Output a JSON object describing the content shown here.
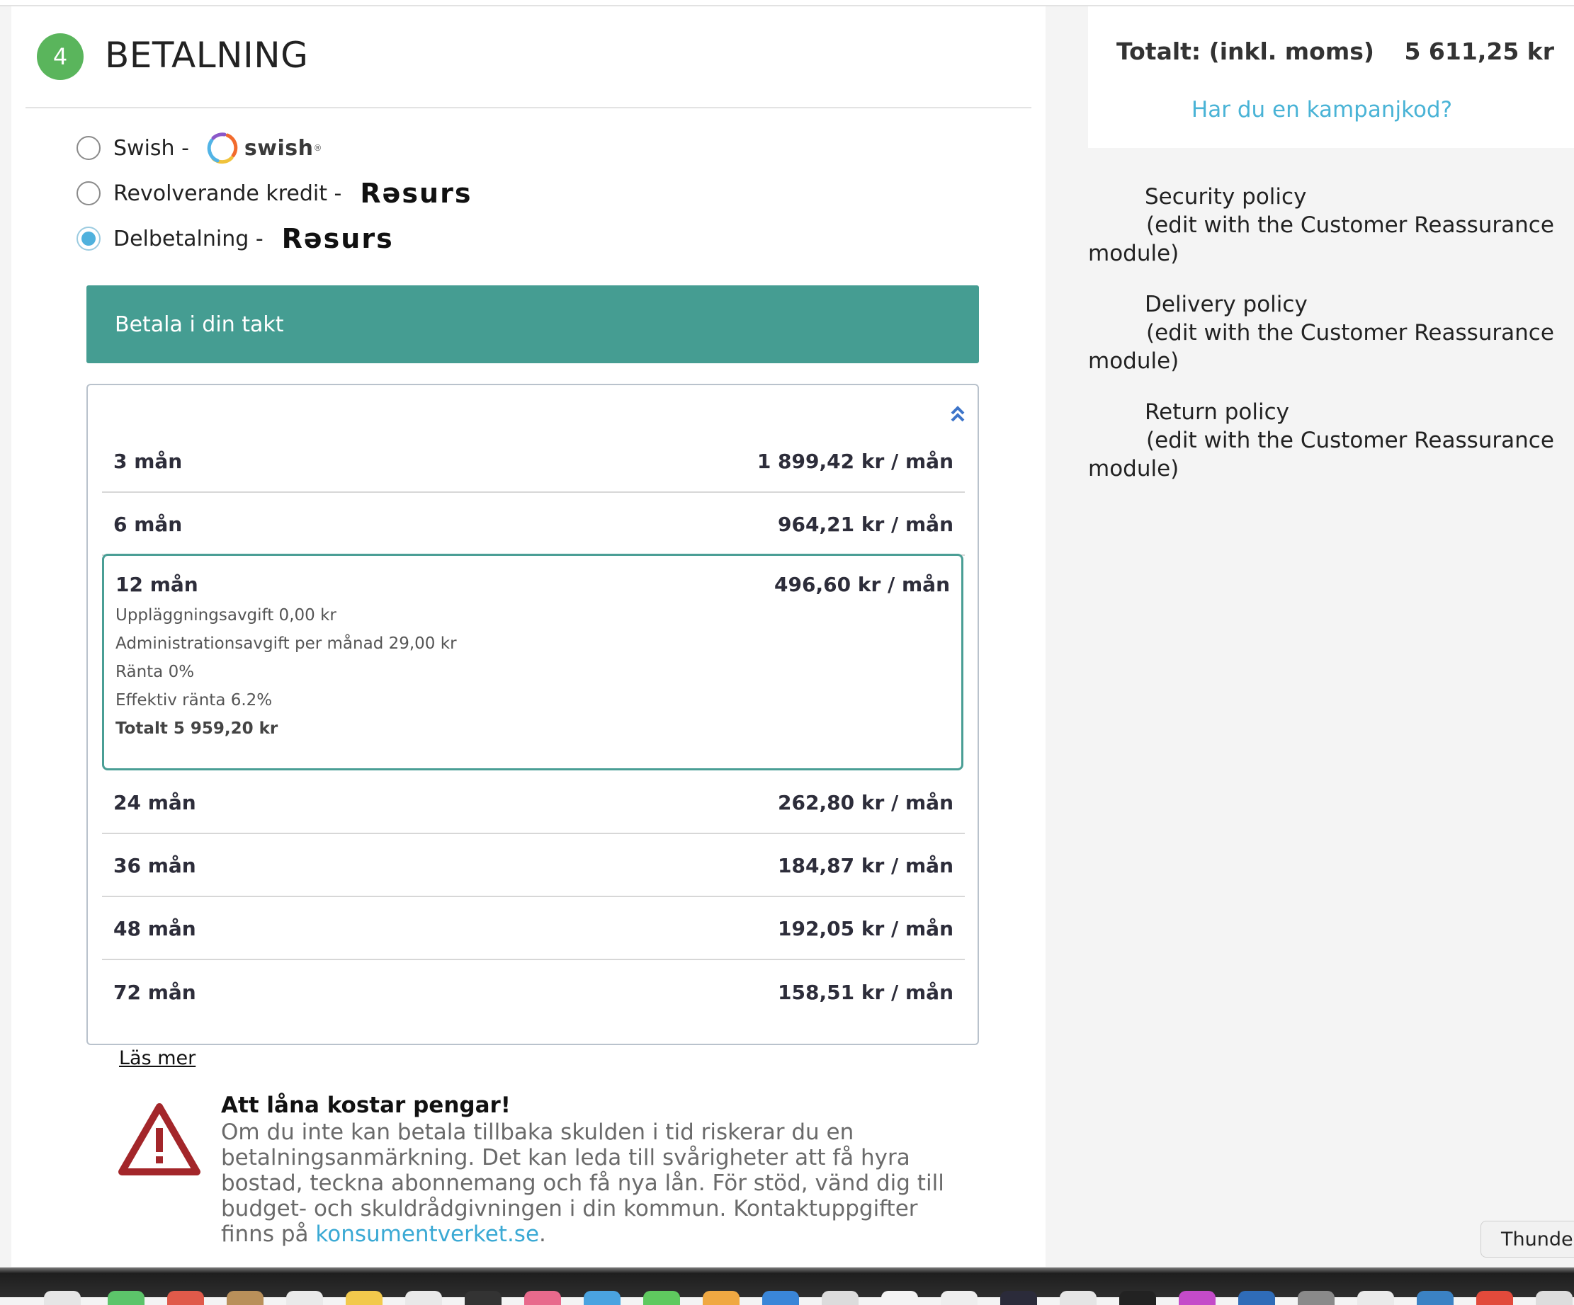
{
  "checkout": {
    "step_number": "4",
    "step_title": "BETALNING",
    "payment_options": [
      {
        "label": "Swish -",
        "provider": "swish",
        "selected": false
      },
      {
        "label": "Revolverande kredit -",
        "provider": "Rəsurs",
        "selected": false
      },
      {
        "label": "Delbetalning -",
        "provider": "Rəsurs",
        "selected": true
      }
    ],
    "swish_logo_text": "swish",
    "swish_registered": "®",
    "plan_header": "Betala i din takt",
    "plans": [
      {
        "months": "3 mån",
        "price": "1 899,42 kr / mån"
      },
      {
        "months": "6 mån",
        "price": "964,21 kr / mån"
      },
      {
        "months": "12 mån",
        "price": "496,60 kr / mån"
      },
      {
        "months": "24 mån",
        "price": "262,80 kr / mån"
      },
      {
        "months": "36 mån",
        "price": "184,87 kr / mån"
      },
      {
        "months": "48 mån",
        "price": "192,05 kr / mån"
      },
      {
        "months": "72 mån",
        "price": "158,51 kr / mån"
      }
    ],
    "selected_plan_details": {
      "setup_fee": "Uppläggningsavgift 0,00 kr",
      "admin_fee": "Administrationsavgift per månad 29,00 kr",
      "interest": "Ränta 0%",
      "effective_interest": "Effektiv ränta 6.2%",
      "total": "Totalt 5 959,20 kr"
    },
    "read_more": "Läs mer",
    "warning": {
      "title": "Att låna kostar pengar!",
      "text": "Om du inte kan betala tillbaka skulden i tid riskerar du en betalningsanmärkning. Det kan leda till svårigheter att få hyra bostad, teckna abonnemang och få nya lån. För stöd, vänd dig till budget- och skuldrådgivningen i din kommun. Kontaktuppgifter finns på",
      "link_text": "konsumentverket.se",
      "suffix": "."
    }
  },
  "summary": {
    "total_label": "Totalt: (inkl. moms)",
    "total_value": "5 611,25 kr",
    "campaign_link": "Har du en kampanjkod?"
  },
  "reassurance": [
    {
      "title": "Security policy",
      "note": "(edit with the Customer Reassurance",
      "tail": "module)"
    },
    {
      "title": "Delivery policy",
      "note": "(edit with the Customer Reassurance",
      "tail": "module)"
    },
    {
      "title": "Return policy",
      "note": "(edit with the Customer Reassurance",
      "tail": "module)"
    }
  ],
  "tooltip": "Thunder",
  "colors": {
    "step_green": "#5ab55c",
    "plan_header_teal": "#459d92",
    "selected_border": "#4a9e95",
    "link_blue": "#49b3d6",
    "warning_red": "#a3262a"
  }
}
